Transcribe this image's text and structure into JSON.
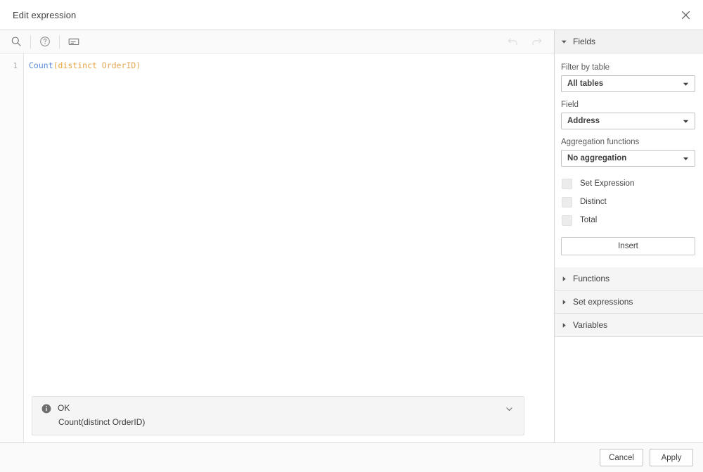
{
  "dialog": {
    "title": "Edit expression",
    "close_icon": "close-icon"
  },
  "toolbar": {
    "search_icon": "search-icon",
    "help_icon": "help-circle-icon",
    "insert_snippet_icon": "insert-field-icon",
    "undo_icon": "undo-arrow-icon",
    "redo_icon": "redo-arrow-icon"
  },
  "editor": {
    "line_number": "1",
    "expression": "Count(distinct OrderID)",
    "tokens": {
      "func": "Count",
      "keyword": "(distinct",
      "field": " OrderID)"
    },
    "colors": {
      "func": "#5b8dd9",
      "keyword": "#e8a33d",
      "field": "#e5a857"
    }
  },
  "validation": {
    "icon": "info-icon",
    "status": "OK",
    "detail": "Count(distinct OrderID)",
    "expand_icon": "chevron-down-icon"
  },
  "side_panel": {
    "sections": [
      {
        "label": "Fields",
        "expanded": true
      },
      {
        "label": "Functions",
        "expanded": false
      },
      {
        "label": "Set expressions",
        "expanded": false
      },
      {
        "label": "Variables",
        "expanded": false
      }
    ],
    "fields": {
      "filter_by_table_label": "Filter by table",
      "filter_by_table_value": "All tables",
      "field_label": "Field",
      "field_value": "Address",
      "aggregation_label": "Aggregation functions",
      "aggregation_value": "No aggregation",
      "checkboxes": [
        {
          "label": "Set Expression",
          "checked": false
        },
        {
          "label": "Distinct",
          "checked": false
        },
        {
          "label": "Total",
          "checked": false
        }
      ],
      "insert_label": "Insert"
    }
  },
  "footer": {
    "cancel_label": "Cancel",
    "apply_label": "Apply"
  }
}
